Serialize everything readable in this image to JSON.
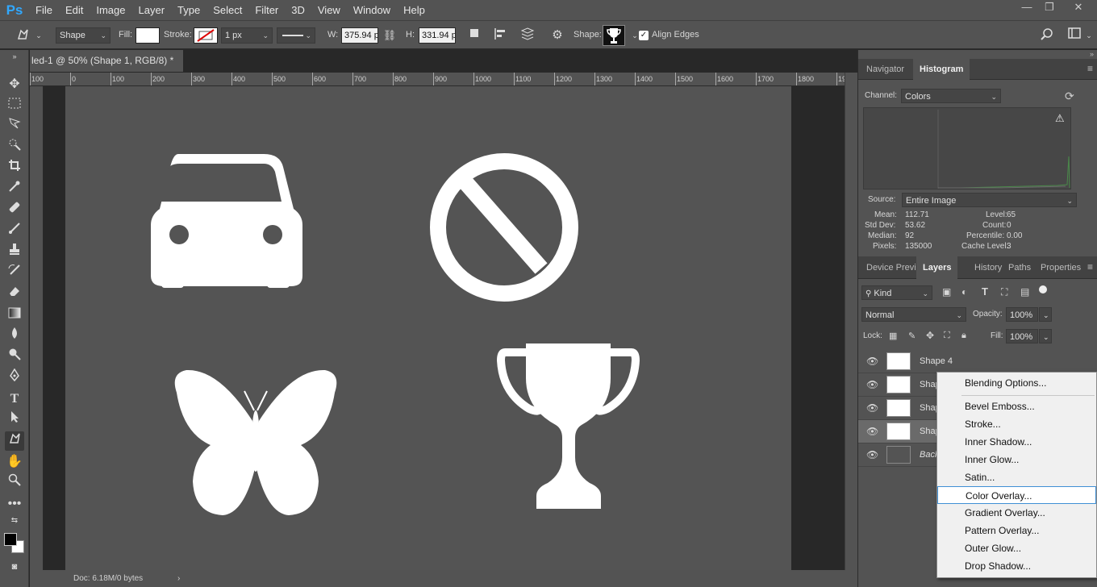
{
  "app": {
    "logo": "Ps",
    "accent": "#31a8ff"
  },
  "menu": [
    "File",
    "Edit",
    "Image",
    "Layer",
    "Type",
    "Select",
    "Filter",
    "3D",
    "View",
    "Window",
    "Help"
  ],
  "window_controls": {
    "minimize": "—",
    "restore": "❐",
    "close": "✕"
  },
  "options": {
    "tool_mode": "Shape",
    "fill_label": "Fill:",
    "stroke_label": "Stroke:",
    "stroke_width": "1 px",
    "w_label": "W:",
    "w_value": "375.94 p",
    "h_label": "H:",
    "h_value": "331.94 p",
    "shape_label": "Shape:",
    "align_edges": "Align Edges"
  },
  "document": {
    "tab_title": "led-1 @ 50% (Shape 1, RGB/8) *",
    "close": "×",
    "status": "Doc: 6.18M/0 bytes",
    "ruler_ticks": [
      "100",
      "0",
      "100",
      "200",
      "300",
      "400",
      "500",
      "600",
      "700",
      "800",
      "900",
      "1000",
      "1100",
      "1200",
      "1300",
      "1400",
      "1500",
      "1600",
      "1700",
      "1800",
      "19"
    ]
  },
  "navigator_panel": {
    "tabs": [
      "Navigator",
      "Histogram"
    ],
    "active_tab": "Histogram",
    "channel_label": "Channel:",
    "channel_value": "Colors",
    "source_label": "Source:",
    "source_value": "Entire Image",
    "stats_left": [
      {
        "label": "Mean:",
        "value": "112.71"
      },
      {
        "label": "Std Dev:",
        "value": "53.62"
      },
      {
        "label": "Median:",
        "value": "92"
      },
      {
        "label": "Pixels:",
        "value": "135000"
      }
    ],
    "stats_right": [
      {
        "label": "Level:",
        "value": "65"
      },
      {
        "label": "Count:",
        "value": "0"
      },
      {
        "label": "Percentile:",
        "value": "0.00"
      },
      {
        "label": "Cache Level:",
        "value": "3"
      }
    ]
  },
  "layers_panel": {
    "tabs": [
      "Device Previe",
      "Layers",
      "History",
      "Paths",
      "Properties"
    ],
    "active_tab": "Layers",
    "kind_label": "Kind",
    "blend_mode": "Normal",
    "opacity_label": "Opacity:",
    "opacity_value": "100%",
    "lock_label": "Lock:",
    "fill_label": "Fill:",
    "fill_value": "100%",
    "layers": [
      {
        "name": "Shape 4"
      },
      {
        "name": "Shap"
      },
      {
        "name": "Shap"
      },
      {
        "name": "Shap"
      },
      {
        "name": "Back"
      }
    ]
  },
  "context_menu": {
    "items": [
      "Blending Options...",
      "Bevel  Emboss...",
      "Stroke...",
      "Inner Shadow...",
      "Inner Glow...",
      "Satin...",
      "Color Overlay...",
      "Gradient Overlay...",
      "Pattern Overlay...",
      "Outer Glow...",
      "Drop Shadow..."
    ],
    "highlighted": "Color Overlay..."
  }
}
